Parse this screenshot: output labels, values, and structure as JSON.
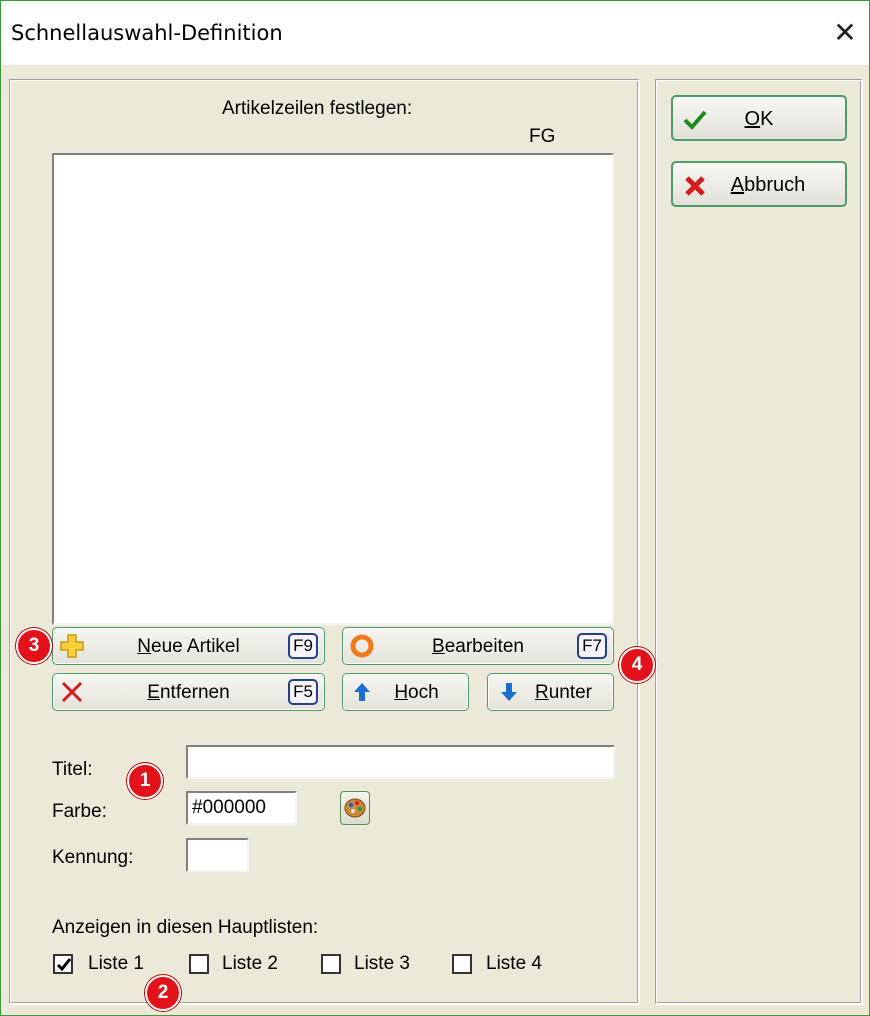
{
  "window": {
    "title": "Schnellauswahl-Definition",
    "close_glyph": "✕"
  },
  "list": {
    "heading": "Artikelzeilen festlegen:",
    "column_header": "FG"
  },
  "buttons": {
    "neue_artikel": {
      "label_accel": "N",
      "label_rest": "eue Artikel",
      "key": "F9",
      "icon": "plus-icon"
    },
    "bearbeiten": {
      "label_accel": "B",
      "label_rest": "earbeiten",
      "key": "F7",
      "icon": "edit-ring-icon"
    },
    "entfernen": {
      "label_accel": "E",
      "label_rest": "ntfernen",
      "key": "F5",
      "icon": "x-delete-icon"
    },
    "hoch": {
      "label_accel": "H",
      "label_rest": "och",
      "icon": "arrow-up-icon"
    },
    "runter": {
      "label_accel": "R",
      "label_rest": "unter",
      "icon": "arrow-down-icon"
    }
  },
  "form": {
    "titel_label": "Titel:",
    "titel_value": "",
    "farbe_label": "Farbe:",
    "farbe_value": "#000000",
    "kennung_label": "Kennung:",
    "kennung_value": ""
  },
  "lists": {
    "heading": "Anzeigen in diesen Hauptlisten:",
    "items": [
      {
        "label": "Liste 1",
        "checked": true
      },
      {
        "label": "Liste 2",
        "checked": false
      },
      {
        "label": "Liste 3",
        "checked": false
      },
      {
        "label": "Liste 4",
        "checked": false
      }
    ]
  },
  "dialog_buttons": {
    "ok": {
      "label_accel": "O",
      "label_rest": "K",
      "icon": "checkmark-icon"
    },
    "abbruch": {
      "label_accel": "A",
      "label_rest": "bbruch",
      "icon": "cancel-x-icon"
    }
  },
  "callouts": [
    "1",
    "2",
    "3",
    "4"
  ],
  "colors": {
    "accent_green": "#4e9a6a",
    "badge_red": "#e3111a",
    "dialog_bg": "#ece9d8"
  }
}
